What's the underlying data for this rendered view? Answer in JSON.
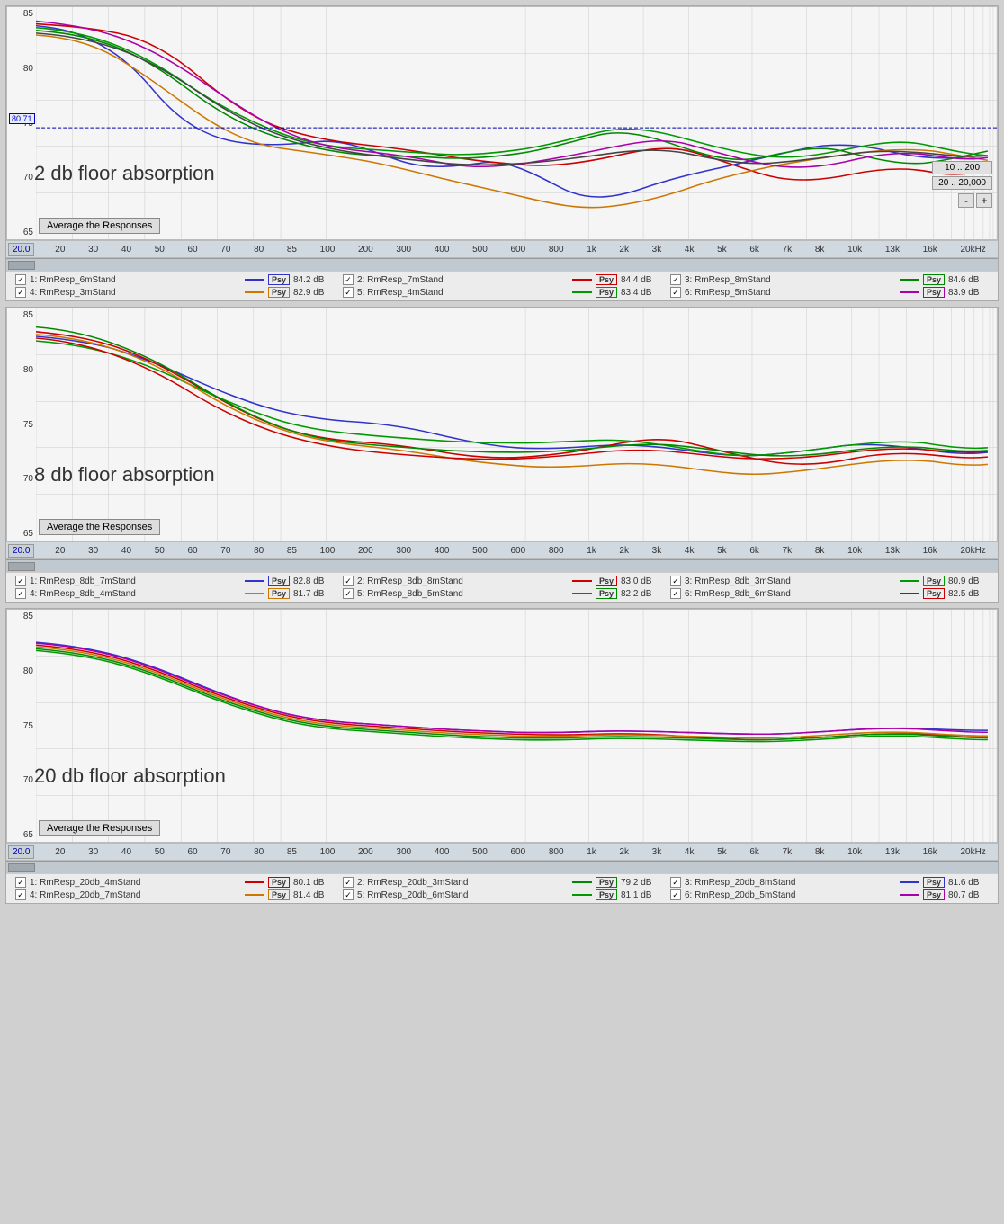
{
  "charts": [
    {
      "id": "chart1",
      "label": "2 db floor absorption",
      "yAxis": [
        "85",
        "80",
        "75",
        "70",
        "65"
      ],
      "startVal": "20.0",
      "rangeButtons": [
        "10 .. 200",
        "20 .. 20,000"
      ],
      "avgBtn": "Average the Responses",
      "xTicks": [
        "20",
        "30",
        "40",
        "50",
        "60",
        "70",
        "80",
        "85",
        "100",
        "200",
        "300",
        "400",
        "500",
        "600",
        "800",
        "1k",
        "2k",
        "3k",
        "4k",
        "5k",
        "6k",
        "7k",
        "8k",
        "10k",
        "13k",
        "16k",
        "20kHz"
      ],
      "yMarker": "80.71",
      "legend": [
        {
          "check": true,
          "name": "1: RmResp_6mStand",
          "color": "#cc0000",
          "lineColor": "#cc0000",
          "psy": "Psy",
          "psyBg": "#cc3333",
          "db": "84.2 dB"
        },
        {
          "check": true,
          "name": "2: RmResp_7mStand",
          "color": "#008800",
          "lineColor": "#008800",
          "psy": "Psy",
          "psyBg": "#009900",
          "db": "84.4 dB"
        },
        {
          "check": true,
          "name": "3: RmResp_8mStand",
          "color": "#cc0000",
          "lineColor": "#aa00aa",
          "psy": "Psy",
          "psyBg": "#cc00cc",
          "db": "84.6 dB"
        },
        {
          "check": true,
          "name": "4: RmResp_3mStand",
          "color": "#cc7700",
          "lineColor": "#cc7700",
          "psy": "Psy",
          "psyBg": "#cc7700",
          "db": "82.9 dB"
        },
        {
          "check": true,
          "name": "5: RmResp_4mStand",
          "color": "#009900",
          "lineColor": "#009900",
          "psy": "Psy",
          "psyBg": "#009900",
          "db": "83.4 dB"
        },
        {
          "check": true,
          "name": "6: RmResp_5mStand",
          "color": "#cc0000",
          "lineColor": "#cc0000",
          "psy": "Psy",
          "psyBg": "#cc0000",
          "db": "83.9 dB"
        }
      ]
    },
    {
      "id": "chart2",
      "label": "8 db floor absorption",
      "yAxis": [
        "85",
        "80",
        "75",
        "70",
        "65"
      ],
      "startVal": "20.0",
      "rangeButtons": [],
      "avgBtn": "Average the Responses",
      "xTicks": [
        "20",
        "30",
        "40",
        "50",
        "60",
        "70",
        "80",
        "85",
        "100",
        "200",
        "300",
        "400",
        "500",
        "600",
        "800",
        "1k",
        "2k",
        "3k",
        "4k",
        "5k",
        "6k",
        "7k",
        "8k",
        "10k",
        "13k",
        "16k",
        "20kHz"
      ],
      "yMarker": "",
      "legend": [
        {
          "check": true,
          "name": "1: RmResp_8db_7mStand",
          "color": "#cc0000",
          "lineColor": "#cc0000",
          "psy": "Psy",
          "psyBg": "#cc3333",
          "db": "82.8 dB"
        },
        {
          "check": true,
          "name": "2: RmResp_8db_8mStand",
          "color": "#008800",
          "lineColor": "#008800",
          "psy": "Psy",
          "psyBg": "#009900",
          "db": "83.0 dB"
        },
        {
          "check": true,
          "name": "3: RmResp_8db_3mStand",
          "color": "#6666cc",
          "lineColor": "#6666cc",
          "psy": "Psy",
          "psyBg": "#6666cc",
          "db": "80.9 dB"
        },
        {
          "check": true,
          "name": "4: RmResp_8db_4mStand",
          "color": "#cc7700",
          "lineColor": "#cc7700",
          "psy": "Psy",
          "psyBg": "#cc7700",
          "db": "81.7 dB"
        },
        {
          "check": true,
          "name": "5: RmResp_8db_5mStand",
          "color": "#009900",
          "lineColor": "#009900",
          "psy": "Psy",
          "psyBg": "#009900",
          "db": "82.2 dB"
        },
        {
          "check": true,
          "name": "6: RmResp_8db_6mStand",
          "color": "#cc0000",
          "lineColor": "#cc0000",
          "psy": "Psy",
          "psyBg": "#cc0000",
          "db": "82.5 dB"
        }
      ]
    },
    {
      "id": "chart3",
      "label": "20 db floor absorption",
      "yAxis": [
        "85",
        "80",
        "75",
        "70",
        "65"
      ],
      "startVal": "20.0",
      "rangeButtons": [],
      "avgBtn": "Average the Responses",
      "xTicks": [
        "20",
        "30",
        "40",
        "50",
        "60",
        "70",
        "80",
        "85",
        "100",
        "200",
        "300",
        "400",
        "500",
        "600",
        "800",
        "1k",
        "2k",
        "3k",
        "4k",
        "5k",
        "6k",
        "7k",
        "8k",
        "10k",
        "13k",
        "16k",
        "20kHz"
      ],
      "yMarker": "",
      "legend": [
        {
          "check": true,
          "name": "1: RmResp_20db_4mStand",
          "color": "#cc0000",
          "lineColor": "#cc0000",
          "psy": "Psy",
          "psyBg": "#cc3333",
          "db": "80.1 dB"
        },
        {
          "check": true,
          "name": "2: RmResp_20db_3mStand",
          "color": "#008800",
          "lineColor": "#008800",
          "psy": "Psy",
          "psyBg": "#009900",
          "db": "79.2 dB"
        },
        {
          "check": true,
          "name": "3: RmResp_20db_8mStand",
          "color": "#6666cc",
          "lineColor": "#6666cc",
          "psy": "Psy",
          "psyBg": "#6666cc",
          "db": "81.6 dB"
        },
        {
          "check": true,
          "name": "4: RmResp_20db_7mStand",
          "color": "#cc7700",
          "lineColor": "#cc7700",
          "psy": "Psy",
          "psyBg": "#cc7700",
          "db": "81.4 dB"
        },
        {
          "check": true,
          "name": "5: RmResp_20db_6mStand",
          "color": "#009900",
          "lineColor": "#009900",
          "psy": "Psy",
          "psyBg": "#009900",
          "db": "81.1 dB"
        },
        {
          "check": true,
          "name": "6: RmResp_20db_5mStand",
          "color": "#cc0000",
          "lineColor": "#cc0000",
          "psy": "Psy",
          "psyBg": "#cc0000",
          "db": "80.7 dB"
        }
      ]
    }
  ],
  "colors": {
    "chart1": {
      "curves": [
        "#3333cc",
        "#cc0000",
        "#008800",
        "#cc7700",
        "#009900",
        "#aa00aa",
        "#555555"
      ]
    },
    "chart2": {
      "curves": [
        "#3333cc",
        "#cc0000",
        "#008800",
        "#cc7700",
        "#009900",
        "#aa00aa"
      ]
    },
    "chart3": {
      "curves": [
        "#3333cc",
        "#cc0000",
        "#008800",
        "#cc7700",
        "#009900",
        "#aa00aa"
      ]
    }
  }
}
